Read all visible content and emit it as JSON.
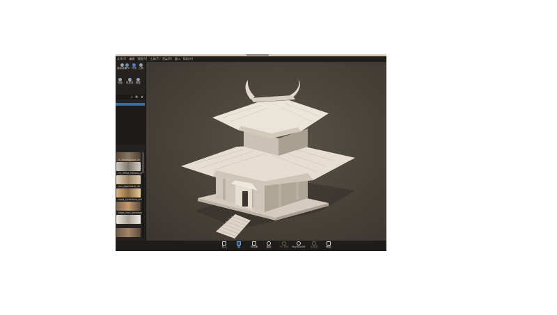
{
  "menu": [
    "文件(F)",
    "编辑",
    "视图(V)",
    "工具(T)",
    "渲染(R)",
    "窗口",
    "帮助(H)"
  ],
  "left_tools": {
    "row1": [
      {
        "icon": "render-icon",
        "label": "渲染设置"
      },
      {
        "icon": "gpu-icon",
        "label": "GPU"
      },
      {
        "icon": "globe-icon",
        "label": "环境"
      },
      {
        "icon": "tool-icon",
        "label": "工具"
      }
    ],
    "row2": [
      {
        "icon": "scene-icon",
        "label": "场景"
      },
      {
        "icon": "material-icon",
        "label": "材质库"
      },
      {
        "icon": "model-icon",
        "label": "模型"
      }
    ]
  },
  "tabbar_icons": "⌕ ⌘ ⚙",
  "thumbnails": [
    {
      "color": "#6b5a48",
      "label": ""
    },
    {
      "color": "#8a8378",
      "label": "...ix_Duttingslope_4k"
    },
    {
      "color": "#a08a70",
      "label": "...ris_Office_hallway_de"
    },
    {
      "color": "#b89a6a",
      "label": "...kon_Apartment_4k"
    },
    {
      "color": "#907860",
      "label": "...kape_cyclorama_studi"
    },
    {
      "color": "#9a8a78",
      "label": "...kape_chou_stoneway"
    },
    {
      "color": "#7a6a58",
      "label": ""
    }
  ],
  "bottom_toolbar": [
    {
      "icon": "import-icon",
      "label": "导入",
      "state": "normal"
    },
    {
      "icon": "edit-icon",
      "label": "展",
      "state": "active"
    },
    {
      "icon": "library-icon",
      "label": "材质库",
      "state": "normal"
    },
    {
      "icon": "render-icon",
      "label": "渲染",
      "state": "normal"
    },
    {
      "icon": "vr-icon",
      "label": "VR 预览",
      "state": "dim"
    },
    {
      "icon": "keyshotweb-icon",
      "label": "KeyShotXR",
      "state": "normal"
    },
    {
      "icon": "pano-icon",
      "label": "全景图",
      "state": "dim"
    },
    {
      "icon": "screenshot-icon",
      "label": "截图",
      "state": "normal"
    }
  ],
  "colors": {
    "viewport_bg": "#4a443b",
    "model": "#e8e0d4",
    "accent": "#2f6ea8"
  }
}
